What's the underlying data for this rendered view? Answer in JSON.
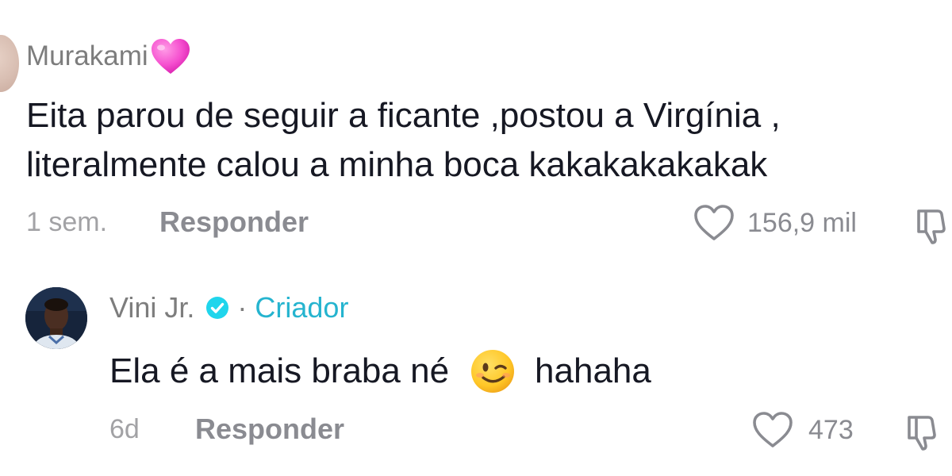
{
  "comments": [
    {
      "username": "Murakami",
      "text_lines": [
        "Eita parou de seguir a ficante ,postou a Virgínia ,",
        "literalmente calou a minha boca kakakakakakak"
      ],
      "time": "1 sem.",
      "reply_label": "Responder",
      "likes": "156,9 mil",
      "icons": {
        "name_emoji": "pink-heart-emoji",
        "like": "heart-outline-icon",
        "dislike": "thumbs-down-icon"
      }
    },
    {
      "username": "Vini Jr.",
      "separator": "·",
      "badge_label": "Criador",
      "text_before_emoji": "Ela é a mais braba né",
      "text_after_emoji": "hahaha",
      "time": "6d",
      "reply_label": "Responder",
      "likes": "473",
      "icons": {
        "verified": "verified-badge-icon",
        "emoji": "winking-face-emoji",
        "like": "heart-outline-icon",
        "dislike": "thumbs-down-icon"
      }
    }
  ],
  "colors": {
    "username": "#7d7d7d",
    "text": "#161823",
    "meta": "#a2a2a5",
    "action": "#8a8b91",
    "creator": "#25b4cf",
    "verified": "#20d5ec"
  }
}
